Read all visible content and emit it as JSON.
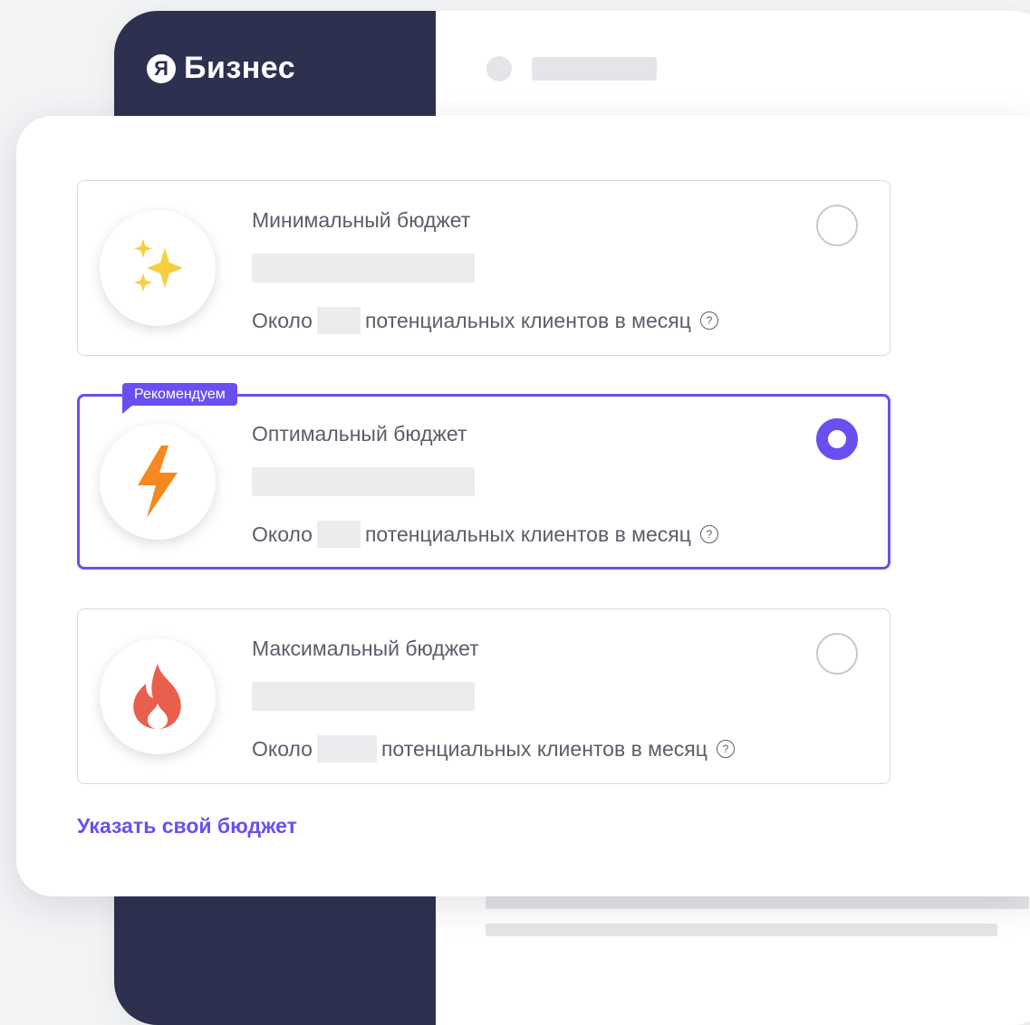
{
  "app": {
    "logo_mark": "Я",
    "logo_text": "Бизнес"
  },
  "colors": {
    "accent": "#6a4ff0",
    "sidebar": "#2e3050"
  },
  "badge": {
    "label": "Рекомендуем"
  },
  "options": [
    {
      "title": "Минимальный бюджет",
      "prefix": "Около",
      "suffix": "потенциальных клиентов в месяц",
      "help": "?",
      "icon": "sparkles-icon",
      "selected": false
    },
    {
      "title": "Оптимальный бюджет",
      "prefix": "Около",
      "suffix": "потенциальных клиентов в месяц",
      "help": "?",
      "icon": "lightning-icon",
      "selected": true
    },
    {
      "title": "Максимальный бюджет",
      "prefix": "Около",
      "suffix": "потенциальных клиентов в месяц",
      "help": "?",
      "icon": "fire-icon",
      "selected": false
    }
  ],
  "custom_budget_link": "Указать свой бюджет"
}
